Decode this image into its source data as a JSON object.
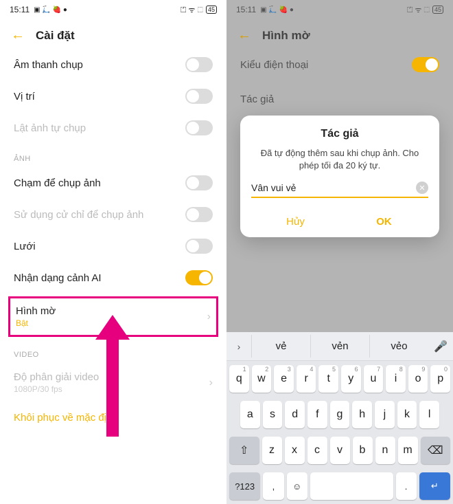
{
  "left": {
    "status": {
      "time": "15:11",
      "battery": "45"
    },
    "header": {
      "title": "Cài đặt"
    },
    "rows": {
      "sound": "Âm thanh chụp",
      "location": "Vị trí",
      "flip": "Lật ảnh tự chụp",
      "section_photo": "ẢNH",
      "tap": "Chạm để chụp ảnh",
      "gesture": "Sử dụng cử chỉ để chụp ảnh",
      "grid": "Lưới",
      "ai": "Nhận dạng cảnh AI",
      "watermark": "Hình mờ",
      "watermark_status": "Bật",
      "section_video": "VIDEO",
      "video_res": "Độ phân giải video",
      "video_res_sub": "1080P/30 fps",
      "restore": "Khôi phục về mặc định"
    }
  },
  "right": {
    "status": {
      "time": "15:11",
      "battery": "45"
    },
    "header": {
      "title": "Hình mờ"
    },
    "rows": {
      "model": "Kiểu điện thoại",
      "author": "Tác giả"
    },
    "dialog": {
      "title": "Tác giả",
      "desc": "Đã tự động thêm sau khi chụp ảnh. Cho phép tối đa 20 ký tự.",
      "input": "Vân vui vẻ",
      "cancel": "Hủy",
      "ok": "OK"
    },
    "keyboard": {
      "suggestions": [
        "vẻ",
        "vẻn",
        "vẻo"
      ],
      "row1": [
        "q",
        "w",
        "e",
        "r",
        "t",
        "y",
        "u",
        "i",
        "o",
        "p"
      ],
      "row1_sup": [
        "1",
        "2",
        "3",
        "4",
        "5",
        "6",
        "7",
        "8",
        "9",
        "0"
      ],
      "row2": [
        "a",
        "s",
        "d",
        "f",
        "g",
        "h",
        "j",
        "k",
        "l"
      ],
      "row3": [
        "z",
        "x",
        "c",
        "v",
        "b",
        "n",
        "m"
      ],
      "shift": "⇧",
      "backspace": "⌫",
      "numkey": "?123",
      "comma": ",",
      "emoji": "☺",
      "space": " ",
      "period": ".",
      "enter": "↵"
    }
  }
}
